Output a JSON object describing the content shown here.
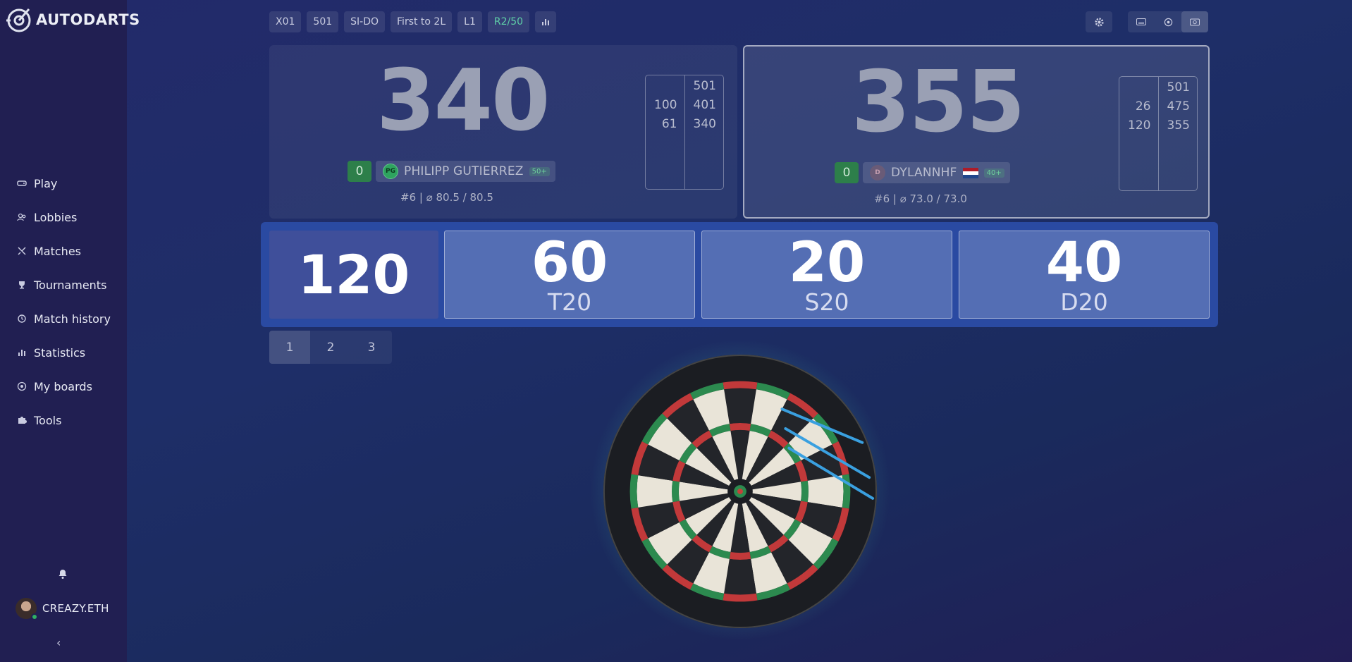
{
  "app": {
    "logo_text": "AUTODARTS"
  },
  "sidebar": {
    "items": [
      {
        "label": "Play",
        "icon": "gamepad-icon"
      },
      {
        "label": "Lobbies",
        "icon": "users-icon"
      },
      {
        "label": "Matches",
        "icon": "swords-icon"
      },
      {
        "label": "Tournaments",
        "icon": "trophy-icon"
      },
      {
        "label": "Match history",
        "icon": "history-icon"
      },
      {
        "label": "Statistics",
        "icon": "bar-chart-icon"
      },
      {
        "label": "My boards",
        "icon": "target-icon"
      },
      {
        "label": "Tools",
        "icon": "puzzle-icon"
      }
    ],
    "username": "CREAZY.ETH",
    "collapse": "‹"
  },
  "topbar": {
    "chips": [
      "X01",
      "501",
      "SI-DO",
      "First to 2L",
      "L1",
      "R2/50"
    ]
  },
  "players": [
    {
      "score": "340",
      "legs": "0",
      "initials": "PG",
      "name": "PHILIPP GUTIERREZ",
      "badge": "50+",
      "stats": "#6 | ⌀ 80.5 / 80.5",
      "history_left": [
        "",
        "100",
        "61"
      ],
      "history_right": [
        "501",
        "401",
        "340"
      ],
      "active": false
    },
    {
      "score": "355",
      "legs": "0",
      "initials": "D",
      "name": "DYLANNHF",
      "badge": "40+",
      "stats": "#6 | ⌀ 73.0 / 73.0",
      "history_left": [
        "",
        "26",
        "120"
      ],
      "history_right": [
        "501",
        "475",
        "355"
      ],
      "active": true
    }
  ],
  "turn": {
    "total": "120",
    "darts": [
      {
        "value": "60",
        "segment": "T20"
      },
      {
        "value": "20",
        "segment": "S20"
      },
      {
        "value": "40",
        "segment": "D20"
      }
    ]
  },
  "dart_tabs": [
    "1",
    "2",
    "3"
  ],
  "colors": {
    "sidebar_bg": "#211f52",
    "accent_green": "#2d7f4a",
    "throws_bg": "#2a4aa2"
  }
}
